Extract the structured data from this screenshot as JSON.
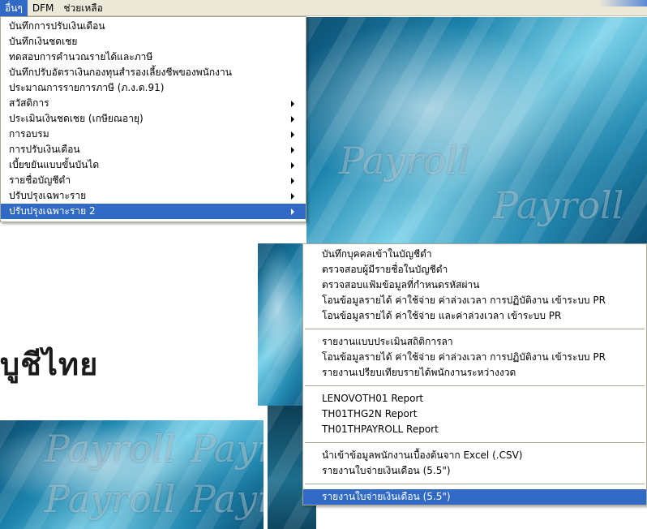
{
  "menubar": {
    "items": [
      {
        "label": "อื่นๆ",
        "active": true
      },
      {
        "label": "DFM",
        "active": false
      },
      {
        "label": "ช่วยเหลือ",
        "active": false
      }
    ]
  },
  "background": {
    "title": "บูชีไทย",
    "watermark": "Payroll"
  },
  "main_menu": {
    "items": [
      {
        "label": "บันทึกการปรับเงินเดือน",
        "submenu": false
      },
      {
        "label": "บันทึกเงินชดเชย",
        "submenu": false
      },
      {
        "label": "ทดสอบการคำนวณรายได้และภาษี",
        "submenu": false
      },
      {
        "label": "บันทึกปรับอัตราเงินกองทุนสำรองเลี้ยงชีพของพนักงาน",
        "submenu": false
      },
      {
        "label": "ประมาณการรายการภาษี (ภ.ง.ด.91)",
        "submenu": false
      },
      {
        "label": "สวัสดิการ",
        "submenu": true
      },
      {
        "label": "ประเมินเงินชดเชย (เกษียณอายุ)",
        "submenu": true
      },
      {
        "label": "การอบรม",
        "submenu": true
      },
      {
        "label": "การปรับเงินเดือน",
        "submenu": true
      },
      {
        "label": "เบี้ยขยันแบบขั้นบันได",
        "submenu": true
      },
      {
        "label": "รายชื่อบัญชีดำ",
        "submenu": true
      },
      {
        "label": "ปรับปรุงเฉพาะราย",
        "submenu": true
      },
      {
        "label": "ปรับปรุงเฉพาะราย 2",
        "submenu": true,
        "highlight": true
      }
    ]
  },
  "sub_menu": {
    "groups": [
      [
        "บันทึกบุคคลเข้าในบัญชีดำ",
        "ตรวจสอบผู้มีรายชื่อในบัญชีดำ",
        "ตรวจสอบแฟ้มข้อมูลที่กำหนดรหัสผ่าน",
        "โอนข้อมูลรายได้ ค่าใช้จ่าย ค่าล่วงเวลา การปฏิบัติงาน เข้าระบบ PR",
        "โอนข้อมูลรายได้ ค่าใช้จ่าย และค่าล่วงเวลา เข้าระบบ PR"
      ],
      [
        "รายงานแบบประเมินสถิติการลา",
        "โอนข้อมูลรายได้ ค่าใช้จ่าย ค่าล่วงเวลา การปฏิบัติงาน เข้าระบบ PR",
        "รายงานเปรียบเทียบรายได้พนักงานระหว่างงวด"
      ],
      [
        "LENOVOTH01 Report",
        "TH01THG2N Report",
        "TH01THPAYROLL Report"
      ],
      [
        "นำเข้าข้อมูลพนักงานเบื้องต้นจาก Excel (.CSV)",
        "รายงานใบจ่ายเงินเดือน (5.5\")"
      ],
      [
        "รายงานใบจ่ายเงินเดือน (5.5\")"
      ]
    ],
    "highlight_group": 4,
    "highlight_index": 0
  },
  "colors": {
    "highlight": "#316ac5",
    "menubar": "#ece9d8"
  }
}
